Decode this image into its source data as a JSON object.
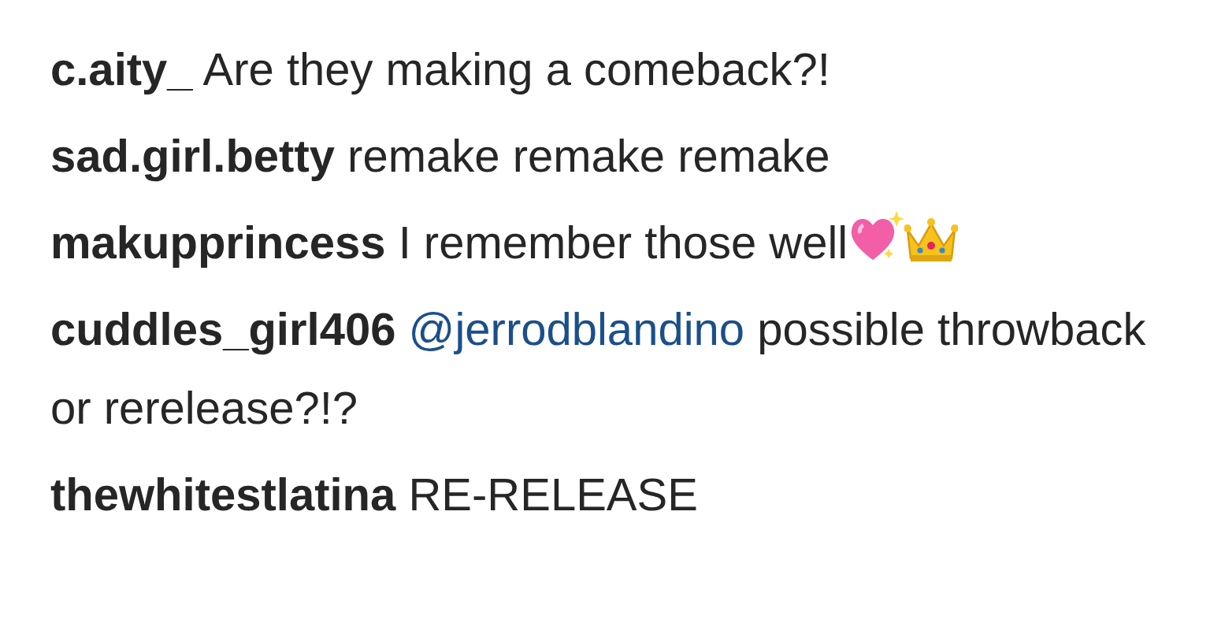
{
  "comments": [
    {
      "user": "c.aity_",
      "parts": [
        {
          "kind": "text",
          "text": "Are they making a comeback?!"
        }
      ]
    },
    {
      "user": "sad.girl.betty",
      "parts": [
        {
          "kind": "text",
          "text": "remake remake remake"
        }
      ]
    },
    {
      "user": "makupprincess",
      "parts": [
        {
          "kind": "text",
          "text": "I remember those well"
        },
        {
          "kind": "heart"
        },
        {
          "kind": "crown"
        }
      ]
    },
    {
      "user": "cuddles_girl406",
      "parts": [
        {
          "kind": "mention",
          "text": "@jerrodblandino"
        },
        {
          "kind": "text",
          "text": "possible throwback or rerelease?!?"
        }
      ]
    },
    {
      "user": "thewhitestlatina",
      "parts": [
        {
          "kind": "text",
          "text": "RE-RELEASE"
        }
      ]
    }
  ]
}
